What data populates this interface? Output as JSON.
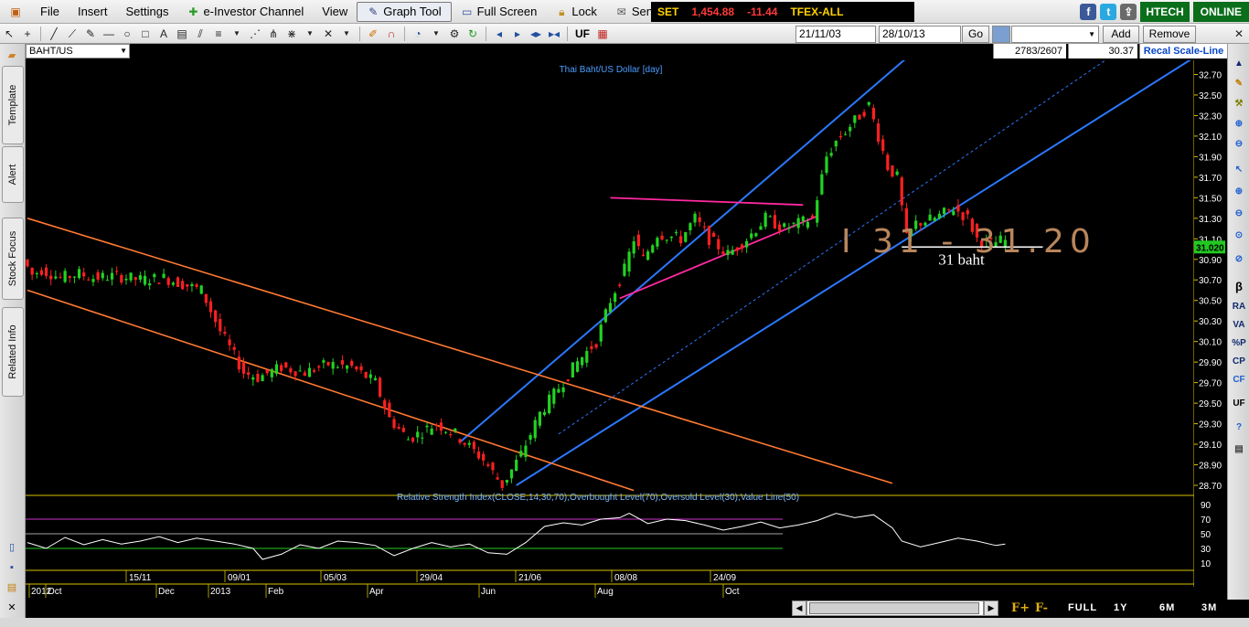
{
  "menu": {
    "file": "File",
    "insert": "Insert",
    "settings": "Settings",
    "einvestor": "e-Investor Channel",
    "view": "View",
    "graph_tool": "Graph Tool",
    "full_screen": "Full Screen",
    "lock": "Lock",
    "send_feedback": "Send Feedback"
  },
  "market": {
    "set_label": "SET",
    "set_value": "1,454.88",
    "set_change": "-11.44",
    "tfex_label": "TFEX-ALL"
  },
  "brand": {
    "htech": "HTECH",
    "online": "ONLINE"
  },
  "toolbar": {
    "uf": "UF",
    "date_from": "21/11/03",
    "date_to": "28/10/13",
    "go": "Go",
    "add": "Add",
    "remove": "Remove"
  },
  "symbol_bar": {
    "symbol": "BAHT/US",
    "bar_counts": "2783/2607",
    "last_value": "30.37",
    "recal": "Recal Scale-Line"
  },
  "left_tabs": [
    "Template",
    "Alert",
    "Stock Focus",
    "Related Info"
  ],
  "right_tools": [
    "β",
    "RA",
    "VA",
    "%P",
    "CP",
    "CF",
    "UF"
  ],
  "bottom": {
    "f_plus": "F+",
    "f_minus": "F-",
    "ranges": [
      "FULL",
      "1Y",
      "6M",
      "3M"
    ]
  },
  "colors": {
    "up": "#22d322",
    "down": "#ff2020",
    "channel_blue": "#2b78ff",
    "channel_orange": "#ff7a33",
    "triangle_pink": "#ff2aa0",
    "rsi_line": "#ffffff",
    "ob_line": "#cc33cc",
    "os_line": "#22cc22"
  },
  "chart_data": {
    "type": "line",
    "title": "Thai Baht/US Dollar [day]",
    "yaxis_ticks": [
      "32.70",
      "32.50",
      "32.30",
      "32.10",
      "31.90",
      "31.70",
      "31.50",
      "31.30",
      "31.10",
      "30.90",
      "30.70",
      "30.50",
      "30.30",
      "30.10",
      "29.90",
      "29.70",
      "29.50",
      "29.30",
      "29.10",
      "28.90",
      "28.70"
    ],
    "ylim": [
      28.62,
      32.82
    ],
    "current_price_label": "31.020",
    "x_ticks_top": [
      "15/11",
      "09/01",
      "05/03",
      "29/04",
      "21/06",
      "08/08",
      "24/09"
    ],
    "x_ticks_bottom": [
      "2012",
      "Oct",
      "Dec",
      "2013",
      "Feb",
      "Apr",
      "Jun",
      "Aug",
      "Oct"
    ],
    "price_path": [
      [
        0,
        30.9
      ],
      [
        2,
        30.75
      ],
      [
        4,
        30.8
      ],
      [
        8,
        30.72
      ],
      [
        12,
        30.76
      ],
      [
        15,
        30.72
      ],
      [
        20,
        30.74
      ],
      [
        25,
        30.7
      ],
      [
        30,
        30.72
      ],
      [
        38,
        30.6
      ],
      [
        42,
        30.2
      ],
      [
        47,
        29.8
      ],
      [
        50,
        29.75
      ],
      [
        55,
        29.85
      ],
      [
        60,
        29.8
      ],
      [
        65,
        29.88
      ],
      [
        70,
        29.85
      ],
      [
        75,
        29.7
      ],
      [
        78,
        29.35
      ],
      [
        82,
        29.15
      ],
      [
        88,
        29.3
      ],
      [
        92,
        29.2
      ],
      [
        98,
        28.95
      ],
      [
        102,
        28.7
      ],
      [
        106,
        29.0
      ],
      [
        110,
        29.4
      ],
      [
        114,
        29.65
      ],
      [
        118,
        29.9
      ],
      [
        122,
        30.1
      ],
      [
        125,
        30.5
      ],
      [
        128,
        30.8
      ],
      [
        130,
        31.1
      ],
      [
        132,
        30.9
      ],
      [
        135,
        31.15
      ],
      [
        140,
        31.1
      ],
      [
        143,
        31.3
      ],
      [
        146,
        31.1
      ],
      [
        150,
        30.95
      ],
      [
        154,
        31.1
      ],
      [
        158,
        31.3
      ],
      [
        162,
        31.2
      ],
      [
        165,
        31.25
      ],
      [
        168,
        31.3
      ],
      [
        171,
        31.9
      ],
      [
        173,
        32.05
      ],
      [
        176,
        32.2
      ],
      [
        178,
        32.3
      ],
      [
        180,
        32.4
      ],
      [
        182,
        32.1
      ],
      [
        184,
        31.8
      ],
      [
        186,
        31.7
      ],
      [
        188,
        31.1
      ],
      [
        190,
        31.25
      ],
      [
        194,
        31.3
      ],
      [
        198,
        31.4
      ],
      [
        201,
        31.3
      ],
      [
        203,
        31.1
      ],
      [
        206,
        31.05
      ],
      [
        208,
        31.08
      ]
    ],
    "channels": [
      {
        "name": "blue-upper",
        "from": [
          92,
          29.12
        ],
        "to": [
          187,
          32.86
        ]
      },
      {
        "name": "blue-lower",
        "from": [
          104,
          28.7
        ],
        "to": [
          248,
          32.86
        ]
      },
      {
        "name": "blue-mid",
        "from": [
          113,
          29.2
        ],
        "to": [
          230,
          32.86
        ]
      },
      {
        "name": "orange-upper",
        "from": [
          0,
          31.3
        ],
        "to": [
          184,
          28.72
        ]
      },
      {
        "name": "orange-lower",
        "from": [
          0,
          30.6
        ],
        "to": [
          129,
          28.65
        ]
      }
    ],
    "triangle": [
      {
        "from": [
          124,
          31.5
        ],
        "to": [
          165,
          31.43
        ]
      },
      {
        "from": [
          126,
          30.52
        ],
        "to": [
          168,
          31.32
        ]
      }
    ],
    "support_line": {
      "from": [
        186,
        31.02
      ],
      "to": [
        216,
        31.02
      ],
      "label": "31 baht"
    },
    "handwritten_note": "I 31 - 31.20",
    "rsi": {
      "label": "Relative Strength Index(CLOSE,14,30,70),Overbought Level(70),Oversold Level(30),Value Line(50)",
      "yaxis_ticks": [
        "90",
        "70",
        "50",
        "30",
        "10"
      ],
      "ylim": [
        0,
        100
      ],
      "overbought": 70,
      "oversold": 30,
      "values": [
        [
          0,
          38
        ],
        [
          4,
          30
        ],
        [
          8,
          45
        ],
        [
          12,
          35
        ],
        [
          16,
          42
        ],
        [
          20,
          36
        ],
        [
          24,
          40
        ],
        [
          28,
          46
        ],
        [
          32,
          38
        ],
        [
          36,
          44
        ],
        [
          40,
          40
        ],
        [
          44,
          36
        ],
        [
          48,
          30
        ],
        [
          50,
          15
        ],
        [
          54,
          22
        ],
        [
          58,
          35
        ],
        [
          62,
          30
        ],
        [
          66,
          40
        ],
        [
          70,
          38
        ],
        [
          74,
          34
        ],
        [
          78,
          20
        ],
        [
          82,
          30
        ],
        [
          86,
          38
        ],
        [
          90,
          32
        ],
        [
          94,
          36
        ],
        [
          98,
          24
        ],
        [
          102,
          22
        ],
        [
          106,
          38
        ],
        [
          110,
          60
        ],
        [
          114,
          65
        ],
        [
          118,
          62
        ],
        [
          122,
          70
        ],
        [
          126,
          72
        ],
        [
          128,
          78
        ],
        [
          132,
          64
        ],
        [
          136,
          70
        ],
        [
          140,
          68
        ],
        [
          144,
          62
        ],
        [
          148,
          55
        ],
        [
          152,
          60
        ],
        [
          156,
          66
        ],
        [
          160,
          58
        ],
        [
          164,
          62
        ],
        [
          168,
          68
        ],
        [
          172,
          78
        ],
        [
          176,
          72
        ],
        [
          180,
          76
        ],
        [
          184,
          58
        ],
        [
          186,
          40
        ],
        [
          190,
          32
        ],
        [
          194,
          38
        ],
        [
          198,
          44
        ],
        [
          202,
          40
        ],
        [
          206,
          34
        ],
        [
          208,
          36
        ]
      ]
    }
  }
}
